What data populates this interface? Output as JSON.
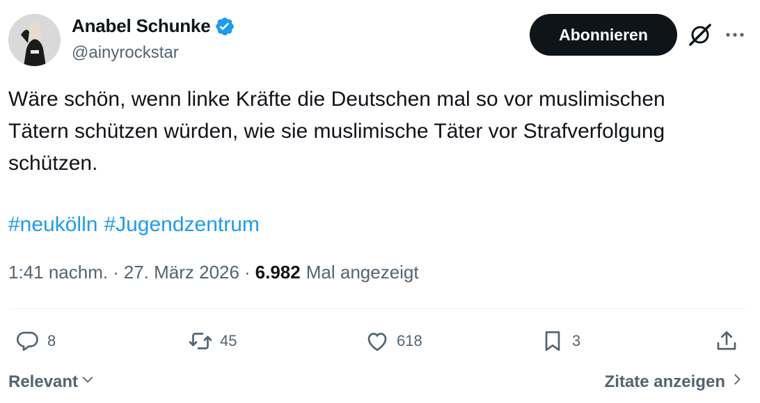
{
  "author": {
    "name": "Anabel Schunke",
    "handle": "@ainyrockstar",
    "verified": true
  },
  "header": {
    "follow_label": "Abonnieren"
  },
  "tweet": {
    "text": "Wäre schön, wenn linke Kräfte die Deutschen mal so vor muslimischen\nTätern schützen würden, wie sie muslimische Täter vor Strafverfolgung\nschützen.",
    "hashtags": [
      "#neukölln",
      "#Jugendzentrum"
    ]
  },
  "meta": {
    "time": "1:41 nachm.",
    "separator": "·",
    "date": "27. März 2026",
    "views_count": "6.982",
    "views_label": "Mal angezeigt"
  },
  "actions": {
    "replies": "8",
    "retweets": "45",
    "likes": "618",
    "bookmarks": "3"
  },
  "footer": {
    "sort_label": "Relevant",
    "quotes_label": "Zitate anzeigen"
  },
  "colors": {
    "text": "#0f1419",
    "secondary": "#536471",
    "link": "#1d9bf0",
    "verified": "#1d9bf0",
    "follow_button_bg": "#0f1419"
  },
  "icons": [
    "verified-badge-icon",
    "grok-icon",
    "more-icon",
    "reply-icon",
    "retweet-icon",
    "like-icon",
    "bookmark-icon",
    "share-icon",
    "chevron-down-icon",
    "chevron-right-icon"
  ]
}
